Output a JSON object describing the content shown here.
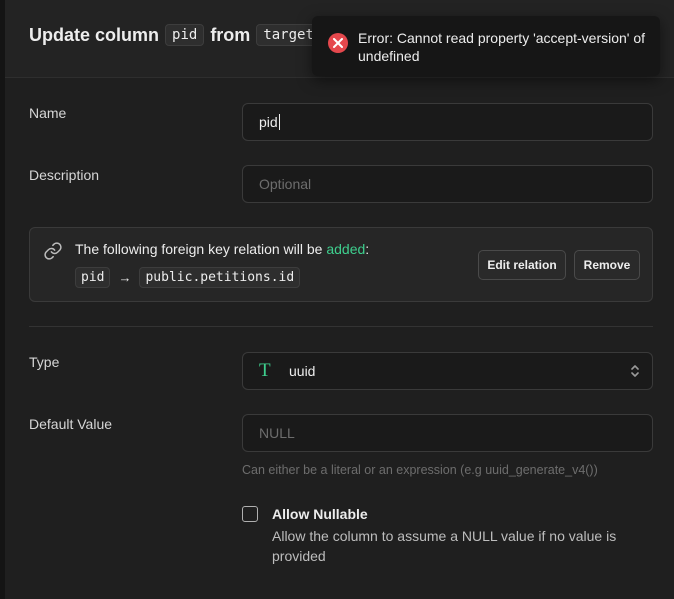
{
  "header": {
    "title_prefix": "Update column",
    "column_name": "pid",
    "from_word": "from",
    "table_name": "targets"
  },
  "toast": {
    "message": "Error: Cannot read property 'accept-version' of undefined",
    "icon": "error-x-icon",
    "color": "#e5484d"
  },
  "form": {
    "name_label": "Name",
    "name_value": "pid",
    "description_label": "Description",
    "description_placeholder": "Optional",
    "foreign_key": {
      "text_before": "The following foreign key relation will be",
      "status_word": "added",
      "text_after": ":",
      "source_column": "pid",
      "arrow": "→",
      "target": "public.petitions.id",
      "edit_button": "Edit relation",
      "remove_button": "Remove",
      "icon": "link-icon"
    },
    "type_label": "Type",
    "type_icon": "T",
    "type_value": "uuid",
    "default_label": "Default Value",
    "default_placeholder": "NULL",
    "default_hint": "Can either be a literal or an expression (e.g uuid_generate_v4())",
    "nullable_title": "Allow Nullable",
    "nullable_description": "Allow the column to assume a NULL value if no value is provided",
    "nullable_checked": false
  },
  "colors": {
    "accent": "#3ecf8e",
    "error": "#e5484d",
    "background": "#1f1f1f"
  }
}
